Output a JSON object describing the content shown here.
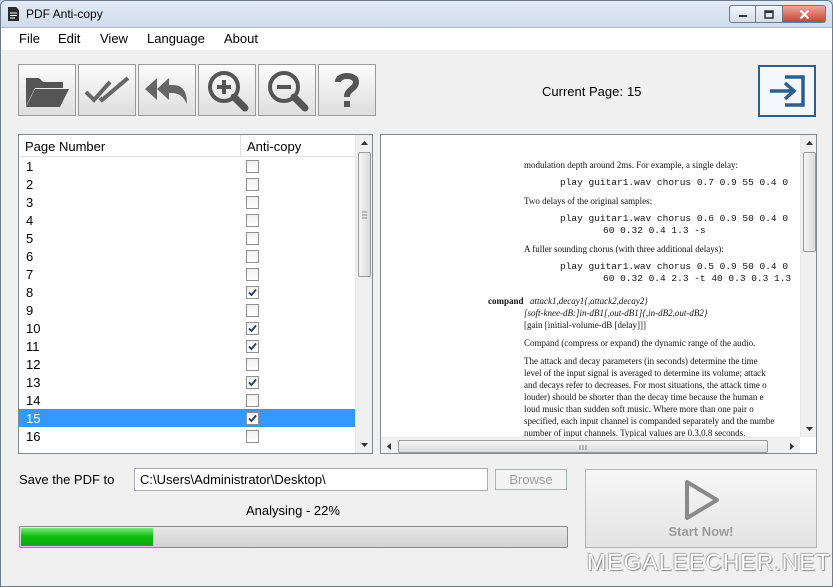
{
  "window": {
    "title": "PDF Anti-copy"
  },
  "menu": [
    "File",
    "Edit",
    "View",
    "Language",
    "About"
  ],
  "toolbar": {
    "buttons": [
      "open-folder-icon",
      "check-all-icon",
      "undo-all-icon",
      "zoom-in-icon",
      "zoom-out-icon",
      "help-icon"
    ],
    "current_page_label": "Current Page:",
    "current_page_value": "15",
    "exit_icon": "exit-icon"
  },
  "list": {
    "headers": [
      "Page Number",
      "Anti-copy"
    ],
    "rows": [
      {
        "page": "1",
        "checked": false
      },
      {
        "page": "2",
        "checked": false
      },
      {
        "page": "3",
        "checked": false
      },
      {
        "page": "4",
        "checked": false
      },
      {
        "page": "5",
        "checked": false
      },
      {
        "page": "6",
        "checked": false
      },
      {
        "page": "7",
        "checked": false
      },
      {
        "page": "8",
        "checked": true
      },
      {
        "page": "9",
        "checked": false
      },
      {
        "page": "10",
        "checked": true
      },
      {
        "page": "11",
        "checked": true
      },
      {
        "page": "12",
        "checked": false
      },
      {
        "page": "13",
        "checked": true
      },
      {
        "page": "14",
        "checked": false
      },
      {
        "page": "15",
        "checked": true,
        "selected": true
      },
      {
        "page": "16",
        "checked": false
      }
    ]
  },
  "preview": {
    "lines": [
      "modulation depth around 2ms.  For example, a single delay:",
      "play guitar1.wav chorus 0.7 0.9 55 0.4 0",
      "Two delays of the original samples:",
      "play guitar1.wav chorus 0.6 0.9 50 0.4 0",
      "60 0.32 0.4 1.3 -s",
      "A fuller sounding chorus (with three additional delays):",
      "play guitar1.wav chorus 0.5 0.9 50 0.4 0",
      "60 0.32 0.4 2.3 -t 40 0.3 0.3 1.3",
      "compand",
      "attack1,decay1{,attack2,decay2}",
      "[soft-knee-dB:]in-dB1[,out-dB1]{,in-dB2,out-dB2}",
      "[gain [initial-volume-dB [delay]]]",
      "Compand (compress or expand) the dynamic range of the audio.",
      "The attack and decay parameters (in seconds) determine the time",
      "level of the input signal is averaged to determine its volume; attack",
      "and decays refer to decreases.  For most situations, the attack time o",
      "louder) should be shorter than the decay time because the human e",
      "loud music than sudden soft music.  Where more than one pair o",
      "specified, each input channel is companded separately and the numbe",
      "number of input channels.  Typical values are 0.3,0.8 seconds."
    ]
  },
  "save": {
    "label": "Save the PDF to",
    "path": "C:\\Users\\Administrator\\Desktop\\",
    "browse_label": "Browse"
  },
  "status": {
    "text": "Analysing - 22%",
    "progress": 0.22
  },
  "start_button": {
    "label": "Start Now!"
  },
  "watermark": "MEGALEECHER.NET",
  "colors": {
    "selection": "#3399ff",
    "progress_green": "#11bf11",
    "exit_border": "#2a5f91"
  }
}
